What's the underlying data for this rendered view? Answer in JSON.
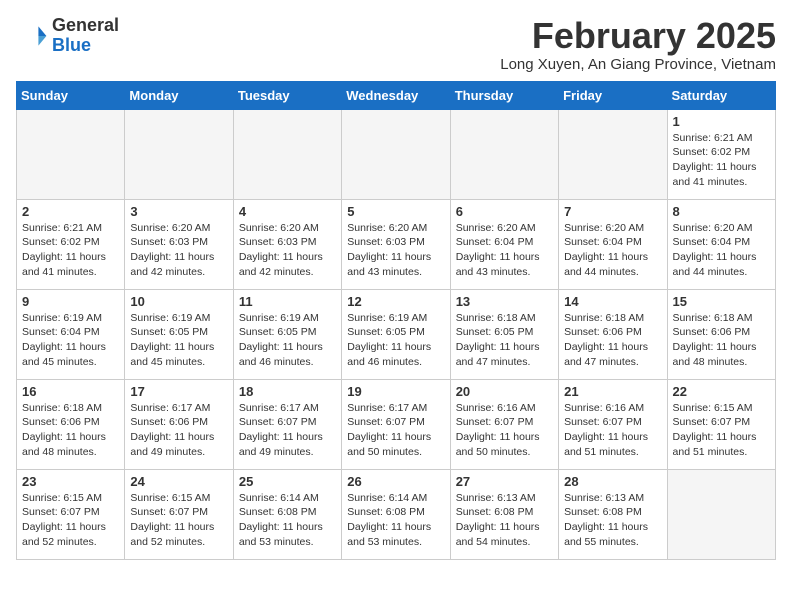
{
  "header": {
    "logo_general": "General",
    "logo_blue": "Blue",
    "month_year": "February 2025",
    "location": "Long Xuyen, An Giang Province, Vietnam"
  },
  "weekdays": [
    "Sunday",
    "Monday",
    "Tuesday",
    "Wednesday",
    "Thursday",
    "Friday",
    "Saturday"
  ],
  "weeks": [
    [
      {
        "day": "",
        "info": ""
      },
      {
        "day": "",
        "info": ""
      },
      {
        "day": "",
        "info": ""
      },
      {
        "day": "",
        "info": ""
      },
      {
        "day": "",
        "info": ""
      },
      {
        "day": "",
        "info": ""
      },
      {
        "day": "1",
        "info": "Sunrise: 6:21 AM\nSunset: 6:02 PM\nDaylight: 11 hours\nand 41 minutes."
      }
    ],
    [
      {
        "day": "2",
        "info": "Sunrise: 6:21 AM\nSunset: 6:02 PM\nDaylight: 11 hours\nand 41 minutes."
      },
      {
        "day": "3",
        "info": "Sunrise: 6:20 AM\nSunset: 6:03 PM\nDaylight: 11 hours\nand 42 minutes."
      },
      {
        "day": "4",
        "info": "Sunrise: 6:20 AM\nSunset: 6:03 PM\nDaylight: 11 hours\nand 42 minutes."
      },
      {
        "day": "5",
        "info": "Sunrise: 6:20 AM\nSunset: 6:03 PM\nDaylight: 11 hours\nand 43 minutes."
      },
      {
        "day": "6",
        "info": "Sunrise: 6:20 AM\nSunset: 6:04 PM\nDaylight: 11 hours\nand 43 minutes."
      },
      {
        "day": "7",
        "info": "Sunrise: 6:20 AM\nSunset: 6:04 PM\nDaylight: 11 hours\nand 44 minutes."
      },
      {
        "day": "8",
        "info": "Sunrise: 6:20 AM\nSunset: 6:04 PM\nDaylight: 11 hours\nand 44 minutes."
      }
    ],
    [
      {
        "day": "9",
        "info": "Sunrise: 6:19 AM\nSunset: 6:04 PM\nDaylight: 11 hours\nand 45 minutes."
      },
      {
        "day": "10",
        "info": "Sunrise: 6:19 AM\nSunset: 6:05 PM\nDaylight: 11 hours\nand 45 minutes."
      },
      {
        "day": "11",
        "info": "Sunrise: 6:19 AM\nSunset: 6:05 PM\nDaylight: 11 hours\nand 46 minutes."
      },
      {
        "day": "12",
        "info": "Sunrise: 6:19 AM\nSunset: 6:05 PM\nDaylight: 11 hours\nand 46 minutes."
      },
      {
        "day": "13",
        "info": "Sunrise: 6:18 AM\nSunset: 6:05 PM\nDaylight: 11 hours\nand 47 minutes."
      },
      {
        "day": "14",
        "info": "Sunrise: 6:18 AM\nSunset: 6:06 PM\nDaylight: 11 hours\nand 47 minutes."
      },
      {
        "day": "15",
        "info": "Sunrise: 6:18 AM\nSunset: 6:06 PM\nDaylight: 11 hours\nand 48 minutes."
      }
    ],
    [
      {
        "day": "16",
        "info": "Sunrise: 6:18 AM\nSunset: 6:06 PM\nDaylight: 11 hours\nand 48 minutes."
      },
      {
        "day": "17",
        "info": "Sunrise: 6:17 AM\nSunset: 6:06 PM\nDaylight: 11 hours\nand 49 minutes."
      },
      {
        "day": "18",
        "info": "Sunrise: 6:17 AM\nSunset: 6:07 PM\nDaylight: 11 hours\nand 49 minutes."
      },
      {
        "day": "19",
        "info": "Sunrise: 6:17 AM\nSunset: 6:07 PM\nDaylight: 11 hours\nand 50 minutes."
      },
      {
        "day": "20",
        "info": "Sunrise: 6:16 AM\nSunset: 6:07 PM\nDaylight: 11 hours\nand 50 minutes."
      },
      {
        "day": "21",
        "info": "Sunrise: 6:16 AM\nSunset: 6:07 PM\nDaylight: 11 hours\nand 51 minutes."
      },
      {
        "day": "22",
        "info": "Sunrise: 6:15 AM\nSunset: 6:07 PM\nDaylight: 11 hours\nand 51 minutes."
      }
    ],
    [
      {
        "day": "23",
        "info": "Sunrise: 6:15 AM\nSunset: 6:07 PM\nDaylight: 11 hours\nand 52 minutes."
      },
      {
        "day": "24",
        "info": "Sunrise: 6:15 AM\nSunset: 6:07 PM\nDaylight: 11 hours\nand 52 minutes."
      },
      {
        "day": "25",
        "info": "Sunrise: 6:14 AM\nSunset: 6:08 PM\nDaylight: 11 hours\nand 53 minutes."
      },
      {
        "day": "26",
        "info": "Sunrise: 6:14 AM\nSunset: 6:08 PM\nDaylight: 11 hours\nand 53 minutes."
      },
      {
        "day": "27",
        "info": "Sunrise: 6:13 AM\nSunset: 6:08 PM\nDaylight: 11 hours\nand 54 minutes."
      },
      {
        "day": "28",
        "info": "Sunrise: 6:13 AM\nSunset: 6:08 PM\nDaylight: 11 hours\nand 55 minutes."
      },
      {
        "day": "",
        "info": ""
      }
    ]
  ]
}
